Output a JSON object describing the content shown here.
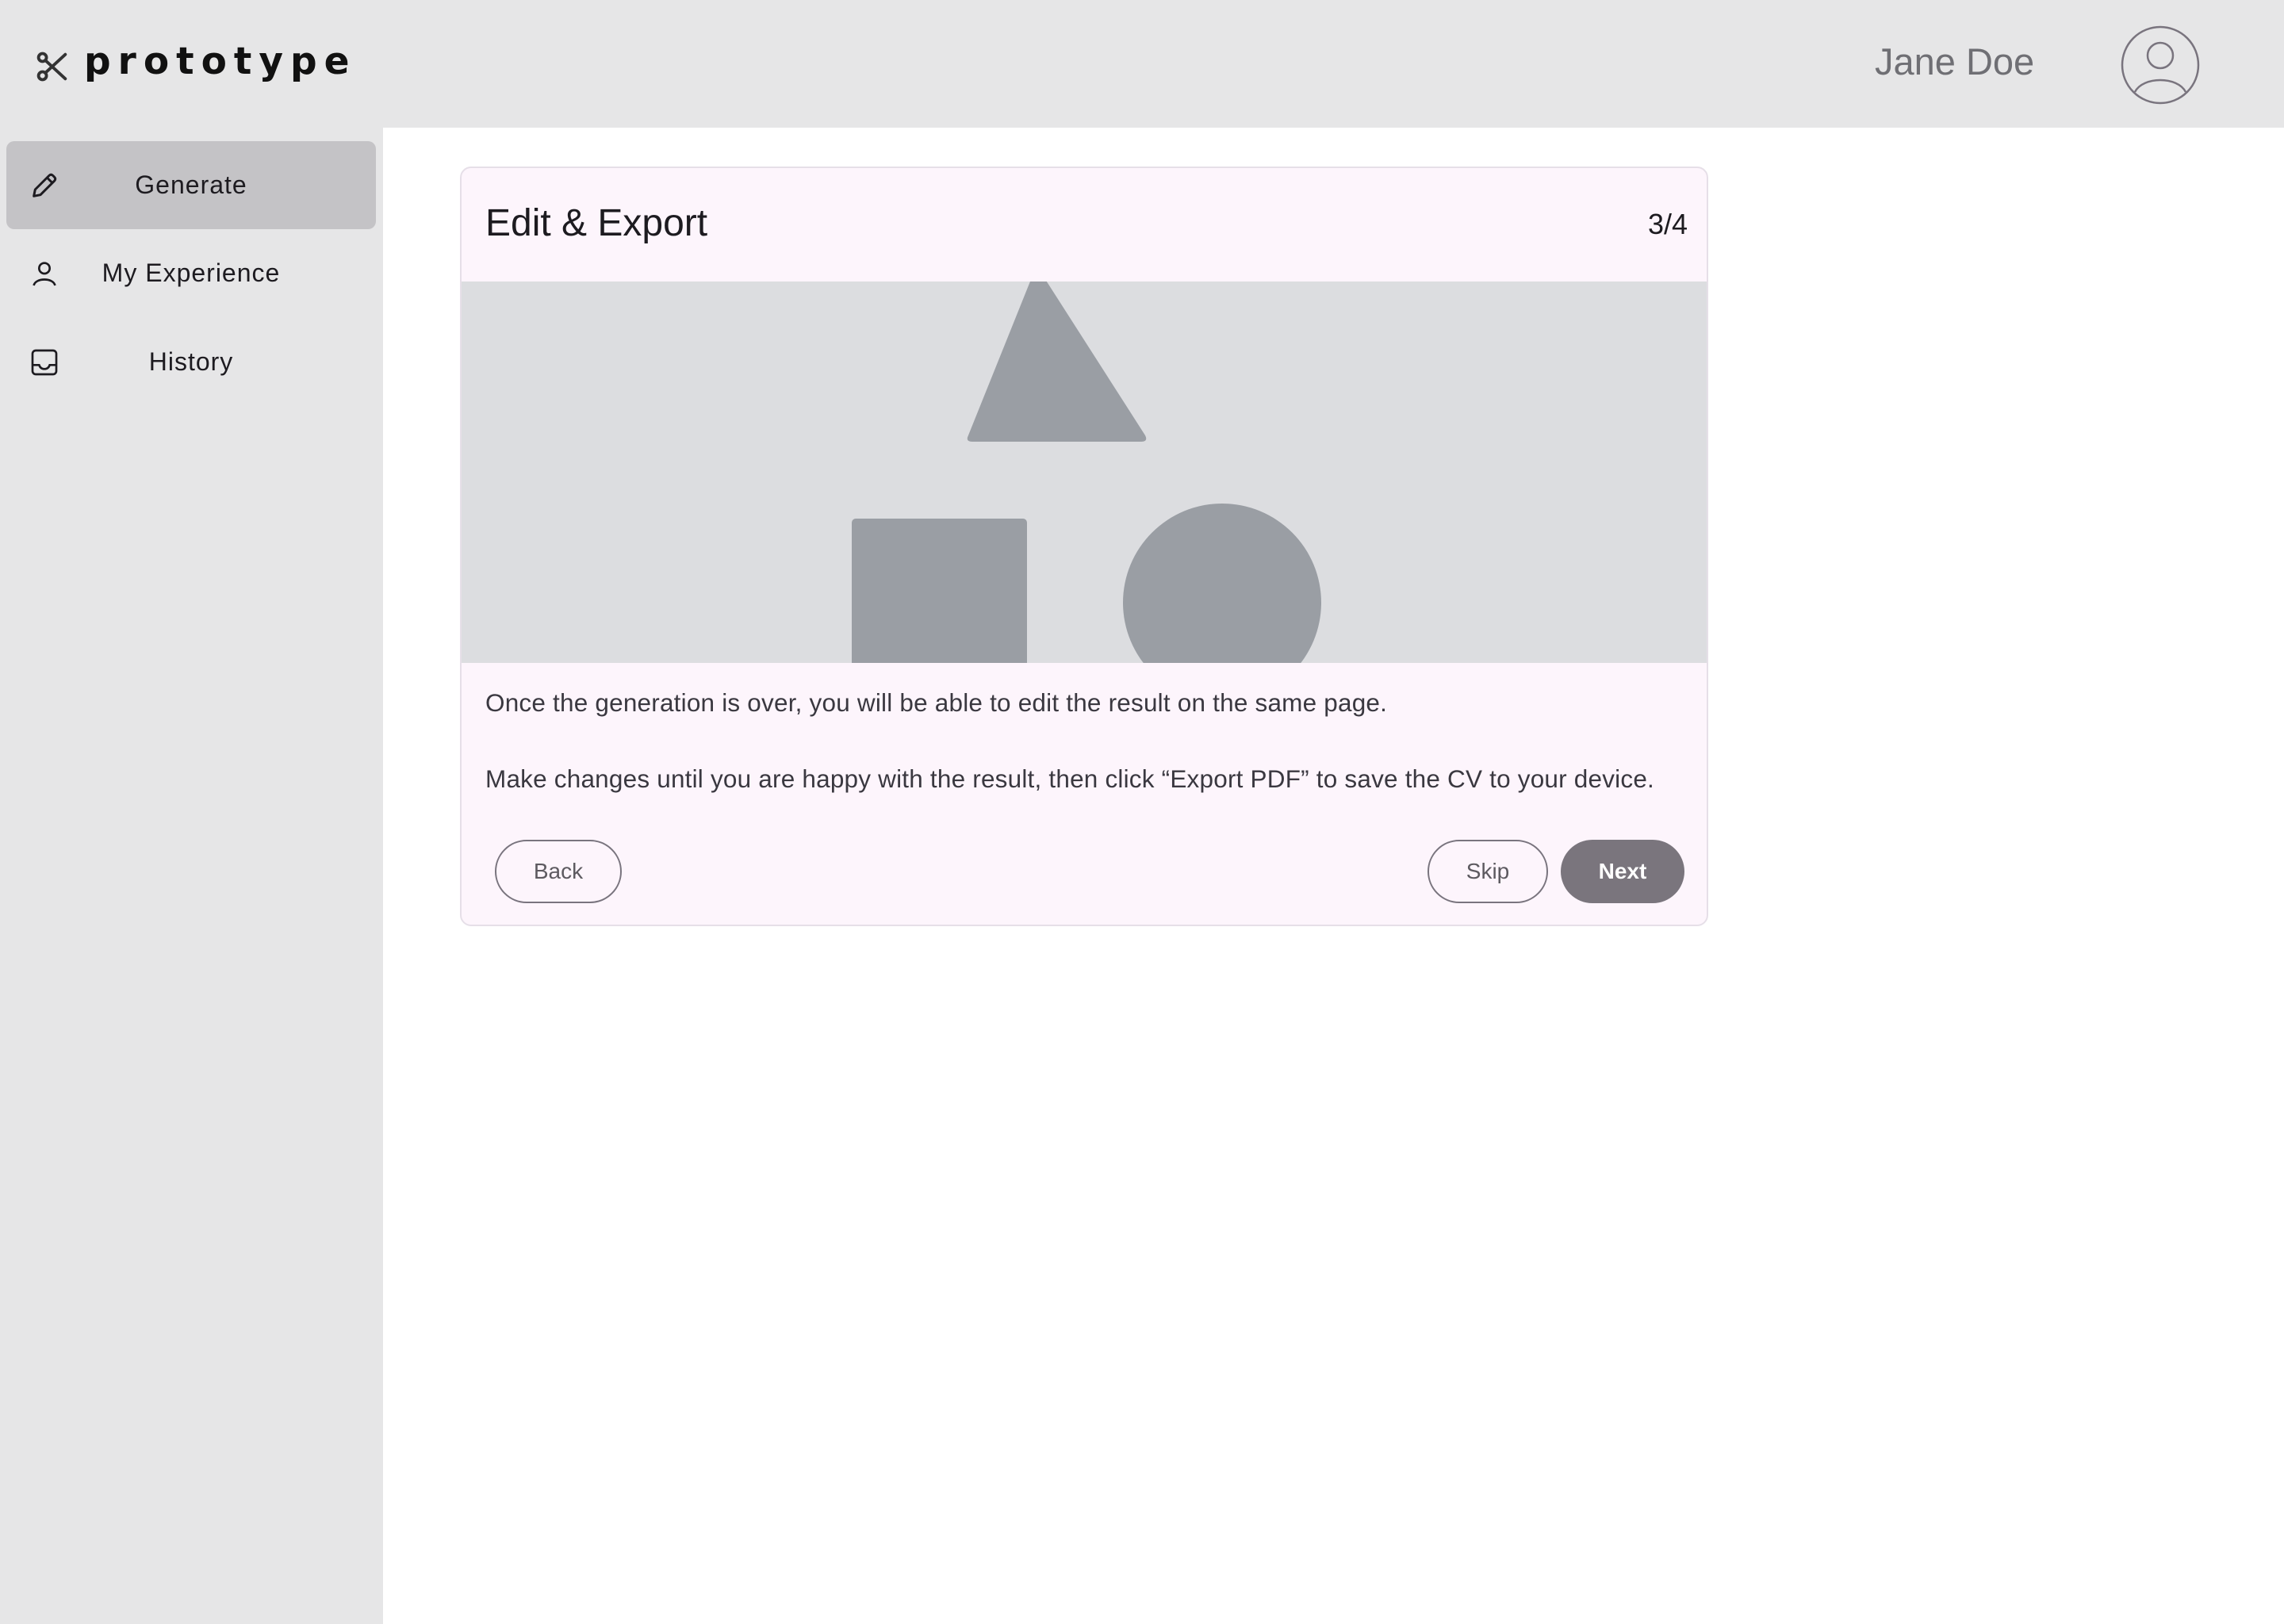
{
  "header": {
    "logo_text": "prototype",
    "logo_icon": "scissors-icon",
    "user_name": "Jane Doe",
    "avatar_icon": "user-circle-icon"
  },
  "sidebar": {
    "items": [
      {
        "label": "Generate",
        "icon": "pencil-icon",
        "active": true
      },
      {
        "label": "My Experience",
        "icon": "person-icon",
        "active": false
      },
      {
        "label": "History",
        "icon": "inbox-icon",
        "active": false
      }
    ]
  },
  "card": {
    "title": "Edit & Export",
    "step": "3/4",
    "media_placeholder": "shapes-placeholder-image",
    "paragraphs": [
      "Once the generation is over, you will be able to edit the result on the same page.",
      "Make changes until you are happy with the result, then click “Export PDF” to save the CV to your device."
    ],
    "buttons": {
      "back": "Back",
      "skip": "Skip",
      "next": "Next"
    }
  },
  "colors": {
    "sidebar_bg": "#e6e6e7",
    "active_nav_bg": "#c4c3c6",
    "card_bg": "#fdf5fc",
    "media_bg": "#dcdde0",
    "shape_fill": "#9a9ea4",
    "primary_button": "#7a757d"
  }
}
